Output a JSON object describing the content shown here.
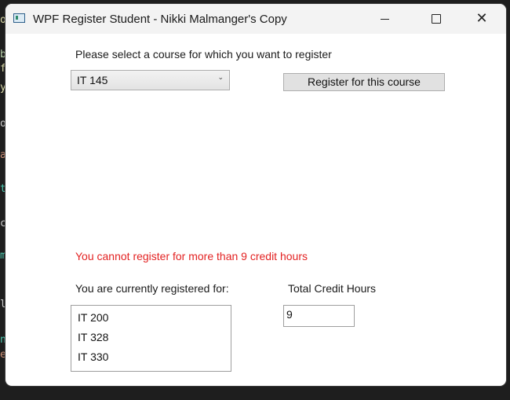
{
  "window": {
    "title": "WPF Register Student - Nikki Malmanger's Copy",
    "controls": {
      "minimize": "—",
      "maximize": "☐",
      "close": "✕"
    }
  },
  "course_prompt": "Please select a course for which you want to register",
  "course_select": {
    "selected": "IT 145"
  },
  "register_button": "Register for this course",
  "error_message": "You cannot register for more than 9 credit hours",
  "registered_label": "You are currently registered for:",
  "registered_courses": [
    "IT 200",
    "IT 328",
    "IT 330"
  ],
  "credit_hours_label": "Total Credit Hours",
  "credit_hours_value": "9",
  "colors": {
    "error": "#e32222",
    "window_bg": "#ffffff",
    "titlebar_bg": "#f3f3f3"
  }
}
